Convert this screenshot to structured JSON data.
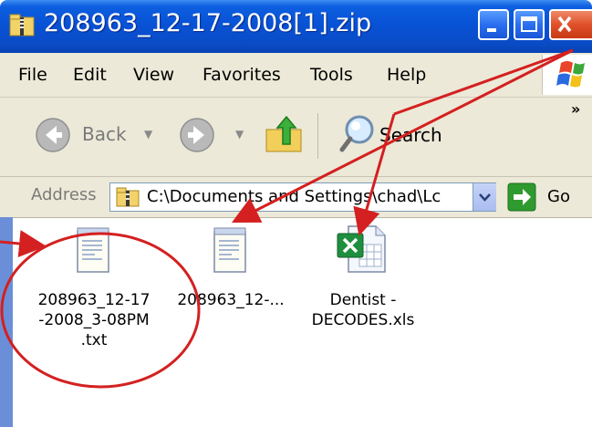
{
  "window": {
    "title": "208963_12-17-2008[1].zip"
  },
  "menu": {
    "items": [
      "File",
      "Edit",
      "View",
      "Favorites",
      "Tools",
      "Help"
    ]
  },
  "toolbar": {
    "back_label": "Back",
    "search_label": "Search",
    "overflow": "»"
  },
  "address": {
    "label": "Address",
    "value": "C:\\Documents and Settings\\chad\\Lc",
    "go_label": "Go"
  },
  "files": [
    {
      "name": "208963_12-17\n-2008_3-08PM\n.txt",
      "icon": "text-file-icon"
    },
    {
      "name": "208963_12-...",
      "icon": "text-file-icon"
    },
    {
      "name": "Dentist -\nDECODES.xls",
      "icon": "excel-file-icon"
    }
  ],
  "colors": {
    "titlebar": "#0852d6",
    "chrome": "#ece9d8",
    "annotation": "#d42020",
    "go_green": "#2f9a2f"
  }
}
